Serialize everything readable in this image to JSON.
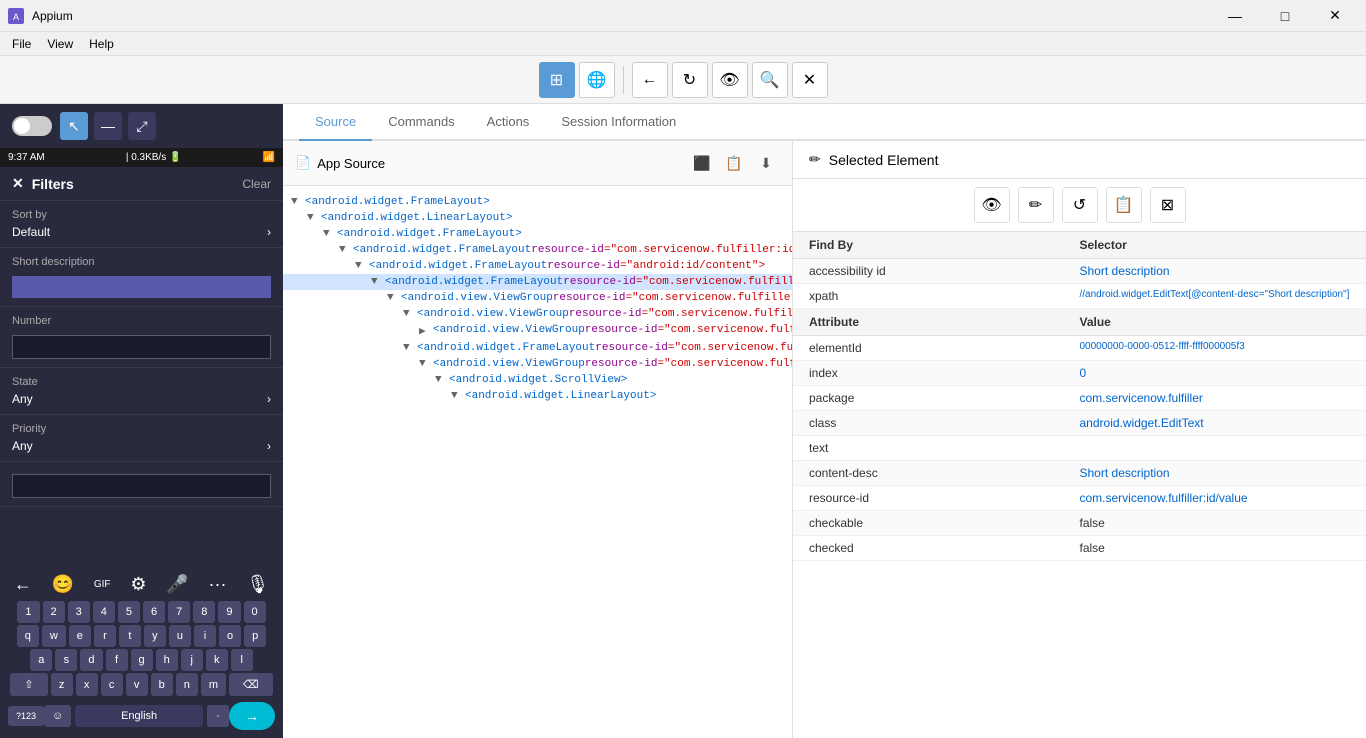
{
  "titleBar": {
    "appName": "Appium",
    "icon": "A",
    "controls": {
      "minimize": "—",
      "maximize": "□",
      "close": "✕"
    }
  },
  "menuBar": {
    "items": [
      "File",
      "View",
      "Help"
    ]
  },
  "toolbar": {
    "buttons": [
      {
        "id": "grid",
        "icon": "⊞",
        "active": true
      },
      {
        "id": "globe",
        "icon": "🌐",
        "active": false
      },
      {
        "id": "back",
        "icon": "←",
        "active": false
      },
      {
        "id": "refresh",
        "icon": "↻",
        "active": false
      },
      {
        "id": "eye",
        "icon": "👁",
        "active": false
      },
      {
        "id": "search",
        "icon": "🔍",
        "active": false
      },
      {
        "id": "close",
        "icon": "✕",
        "active": false
      }
    ]
  },
  "leftPanel": {
    "toggleState": "off",
    "tools": [
      "cursor",
      "minus",
      "expand"
    ],
    "phoneStatus": {
      "time": "9:37 AM",
      "data": "0.3KB/s",
      "battery": "🔋"
    },
    "filters": {
      "title": "Filters",
      "clearLabel": "Clear",
      "closeIcon": "✕",
      "sections": [
        {
          "label": "Sort by",
          "value": "Default",
          "hasArrow": true
        },
        {
          "label": "Short description",
          "hasInput": true,
          "inputValue": ""
        },
        {
          "label": "Number",
          "hasInput": true,
          "inputValue": "",
          "inputType": "plain"
        },
        {
          "label": "State",
          "value": "Any",
          "hasArrow": true
        },
        {
          "label": "Priority",
          "value": "Any",
          "hasArrow": true
        },
        {
          "label": "",
          "hasInput": true,
          "inputValue": "",
          "inputType": "plain"
        }
      ]
    },
    "keyboard": {
      "toolbarIcons": [
        "←",
        "😊",
        "GIF",
        "⚙",
        "🎤",
        "···",
        "🎙"
      ],
      "rows": [
        [
          "1",
          "2",
          "3",
          "4",
          "5",
          "6",
          "7",
          "8",
          "9",
          "0"
        ],
        [
          "q",
          "w",
          "e",
          "r",
          "t",
          "y",
          "u",
          "i",
          "o",
          "p"
        ],
        [
          "a",
          "s",
          "d",
          "f",
          "g",
          "h",
          "j",
          "k",
          "l"
        ],
        [
          "⇧",
          "z",
          "x",
          "c",
          "v",
          "b",
          "n",
          "m",
          "⌫"
        ],
        [
          "?123",
          "☺",
          "⊕",
          "English",
          "·",
          "→"
        ]
      ],
      "bottomLeft": "?123",
      "bottomRight": "→"
    }
  },
  "tabs": {
    "items": [
      {
        "id": "source",
        "label": "Source",
        "active": true
      },
      {
        "id": "commands",
        "label": "Commands",
        "active": false
      },
      {
        "id": "actions",
        "label": "Actions",
        "active": false
      },
      {
        "id": "session",
        "label": "Session Information",
        "active": false
      }
    ]
  },
  "appSource": {
    "title": "App Source",
    "icon": "📄",
    "actions": [
      "⬛",
      "📋",
      "⬇"
    ],
    "xmlTree": [
      {
        "level": 0,
        "toggle": "▼",
        "tag": "<android.widget.FrameLayout>",
        "attr": null,
        "attrVal": null,
        "selected": false
      },
      {
        "level": 1,
        "toggle": "▼",
        "tag": "<android.widget.LinearLayout>",
        "attr": null,
        "attrVal": null,
        "selected": false
      },
      {
        "level": 2,
        "toggle": "▼",
        "tag": "<android.widget.FrameLayout>",
        "attr": null,
        "attrVal": null,
        "selected": false
      },
      {
        "level": 3,
        "toggle": "▼",
        "tag": "<android.widget.FrameLayout ",
        "attr": "resource-id",
        "attrVal": "=\"com.servicenow.fulfiller:id/action_bar_root\">",
        "selected": false
      },
      {
        "level": 4,
        "toggle": "▼",
        "tag": "<android.widget.FrameLayout ",
        "attr": "resource-id",
        "attrVal": "=\"android:id/content\">",
        "selected": false
      },
      {
        "level": 5,
        "toggle": "▼",
        "tag": "<android.widget.FrameLayout ",
        "attr": "resource-id",
        "attrVal": "=\"com.servicenow.fulfiller:id/container\">",
        "selected": true
      },
      {
        "level": 6,
        "toggle": "▼",
        "tag": "<android.view.ViewGroup ",
        "attr": "resource-id",
        "attrVal": "=\"com.servicenow.fulfiller:id/filter_container\">",
        "selected": false
      },
      {
        "level": 7,
        "toggle": "▼",
        "tag": "<android.view.ViewGroup ",
        "attr": "resource-id",
        "attrVal": "=\"com.servicenow.fulfiller:id/topBarLayout\">",
        "selected": false
      },
      {
        "level": 8,
        "toggle": "▶",
        "tag": "<android.view.ViewGroup ",
        "attr": "resource-id",
        "attrVal": "=\"com.servicenow.fulfiller:id/toolbar\">",
        "selected": false
      },
      {
        "level": 7,
        "toggle": "▼",
        "tag": "<android.widget.FrameLayout ",
        "attr": "resource-id",
        "attrVal": "=\"com.servicenow.fulfiller:id/list_container\">",
        "selected": false
      },
      {
        "level": 8,
        "toggle": "▼",
        "tag": "<android.view.ViewGroup ",
        "attr": "resource-id",
        "attrVal": "=\"com.servicenow.fulfiller:id/filter_list_container\">",
        "selected": false
      },
      {
        "level": 9,
        "toggle": "▼",
        "tag": "<android.widget.ScrollView>",
        "attr": null,
        "attrVal": null,
        "selected": false
      },
      {
        "level": 10,
        "toggle": "▼",
        "tag": "<android.widget.LinearLayout>",
        "attr": null,
        "attrVal": null,
        "selected": false
      }
    ]
  },
  "selectedElement": {
    "title": "Selected Element",
    "icon": "✏",
    "actions": [
      "👁",
      "✏",
      "↺",
      "📋",
      "⊠"
    ],
    "findSection": {
      "headers": [
        "Find By",
        "Selector"
      ],
      "rows": [
        {
          "key": "accessibility id",
          "val": "Short description",
          "valColor": "blue"
        },
        {
          "key": "xpath",
          "val": "//android.widget.EditText[@content-desc=\"Short description\"]",
          "valColor": "blue"
        }
      ]
    },
    "attributeSection": {
      "headers": [
        "Attribute",
        "Value"
      ],
      "rows": [
        {
          "key": "elementId",
          "val": "00000000-0000-0512-ffff-ffff000005f3",
          "valColor": "blue"
        },
        {
          "key": "index",
          "val": "0",
          "valColor": "blue"
        },
        {
          "key": "package",
          "val": "com.servicenow.fulfiller",
          "valColor": "blue"
        },
        {
          "key": "class",
          "val": "android.widget.EditText",
          "valColor": "blue"
        },
        {
          "key": "text",
          "val": "",
          "valColor": "normal"
        },
        {
          "key": "content-desc",
          "val": "Short description",
          "valColor": "blue"
        },
        {
          "key": "resource-id",
          "val": "com.servicenow.fulfiller:id/value",
          "valColor": "blue"
        },
        {
          "key": "checkable",
          "val": "false",
          "valColor": "normal"
        },
        {
          "key": "checked",
          "val": "false",
          "valColor": "normal"
        }
      ]
    }
  }
}
